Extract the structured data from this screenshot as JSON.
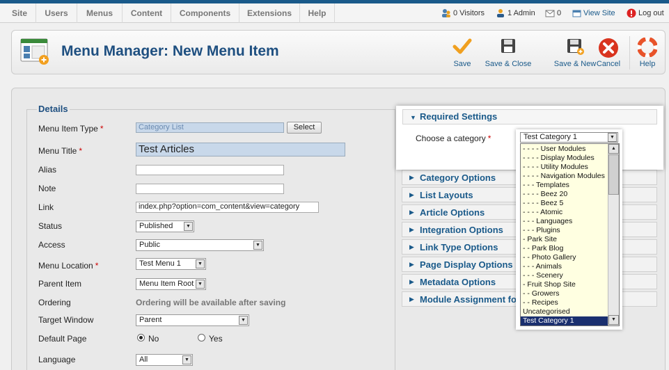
{
  "menu": [
    "Site",
    "Users",
    "Menus",
    "Content",
    "Components",
    "Extensions",
    "Help"
  ],
  "status": {
    "visitors": "0 Visitors",
    "admin": "1 Admin",
    "messages": "0",
    "view_site": "View Site",
    "logout": "Log out"
  },
  "header": {
    "title": "Menu Manager: New Menu Item",
    "save": "Save",
    "save_close": "Save & Close",
    "save_new": "Save & New",
    "cancel": "Cancel",
    "help": "Help"
  },
  "details": {
    "legend": "Details",
    "labels": {
      "menu_item_type": "Menu Item Type",
      "menu_title": "Menu Title",
      "alias": "Alias",
      "note": "Note",
      "link": "Link",
      "status": "Status",
      "access": "Access",
      "menu_location": "Menu Location",
      "parent_item": "Parent Item",
      "ordering": "Ordering",
      "target_window": "Target Window",
      "default_page": "Default Page",
      "language": "Language"
    },
    "required_mark": "*",
    "values": {
      "menu_item_type": "Category List",
      "select_button": "Select",
      "menu_title": "Test Articles",
      "alias": "",
      "note": "",
      "link": "index.php?option=com_content&view=category",
      "status": "Published",
      "access": "Public",
      "menu_location": "Test Menu 1",
      "parent_item": "Menu Item Root",
      "ordering_note": "Ordering will be available after saving",
      "target_window": "Parent",
      "default_no": "No",
      "default_yes": "Yes",
      "language": "All"
    }
  },
  "right": {
    "required_settings": "Required Settings",
    "choose_category": "Choose a category",
    "selected_category": "Test Category 1",
    "panels": [
      "Category Options",
      "List Layouts",
      "Article Options",
      "Integration Options",
      "Link Type Options",
      "Page Display Options",
      "Metadata Options",
      "Module Assignment for"
    ],
    "dropdown_options": [
      "- - - - User Modules",
      "- - - - Display Modules",
      "- - - - Utility Modules",
      "- - - - Navigation Modules",
      "- - - Templates",
      "- - - - Beez 20",
      "- - - - Beez 5",
      "- - - - Atomic",
      "- - - Languages",
      "- - - Plugins",
      "- Park Site",
      "- - Park Blog",
      "- - Photo Gallery",
      "- - - Animals",
      "- - - Scenery",
      "- Fruit Shop Site",
      "- - Growers",
      "- - Recipes",
      "Uncategorised",
      "Test Category 1"
    ]
  }
}
